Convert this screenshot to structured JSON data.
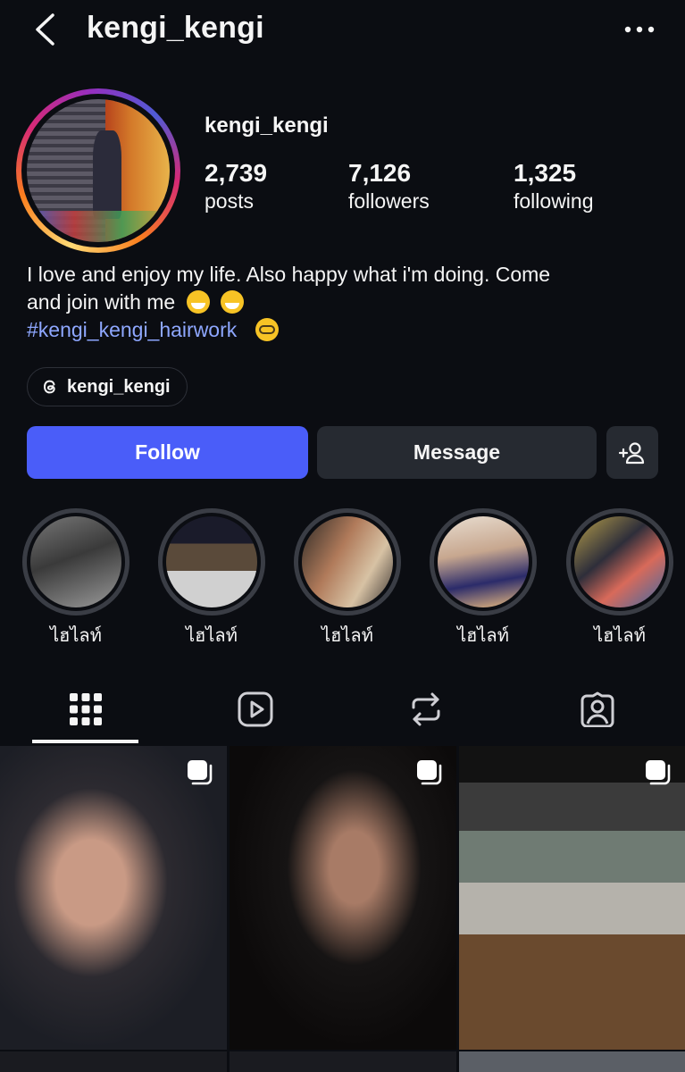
{
  "header": {
    "title": "kengi_kengi",
    "back_icon": "chevron-left-icon",
    "more_icon": "more-horizontal-icon"
  },
  "profile": {
    "username": "kengi_kengi",
    "stats": [
      {
        "value": "2,739",
        "label": "posts"
      },
      {
        "value": "7,126",
        "label": "followers"
      },
      {
        "value": "1,325",
        "label": "following"
      }
    ],
    "bio_line1": "I love and enjoy my life. Also happy what i'm doing. Come",
    "bio_line2": "and join with me",
    "hashtag": "#kengi_kengi_hairwork",
    "threads_handle": "kengi_kengi"
  },
  "actions": {
    "follow": "Follow",
    "message": "Message",
    "add_user_icon": "add-user-icon"
  },
  "highlights": [
    {
      "label": "ไฮไลท์"
    },
    {
      "label": "ไฮไลท์"
    },
    {
      "label": "ไฮไลท์"
    },
    {
      "label": "ไฮไลท์"
    },
    {
      "label": "ไฮไลท์"
    }
  ],
  "tabs": [
    {
      "name": "posts",
      "icon": "grid-icon",
      "active": true
    },
    {
      "name": "reels",
      "icon": "reels-icon",
      "active": false
    },
    {
      "name": "reposts",
      "icon": "repost-icon",
      "active": false
    },
    {
      "name": "tagged",
      "icon": "tagged-icon",
      "active": false
    }
  ],
  "colors": {
    "background": "#0b0d12",
    "follow_button": "#4a5df9",
    "secondary_button": "#262a31",
    "hashtag": "#8ea7ff"
  }
}
